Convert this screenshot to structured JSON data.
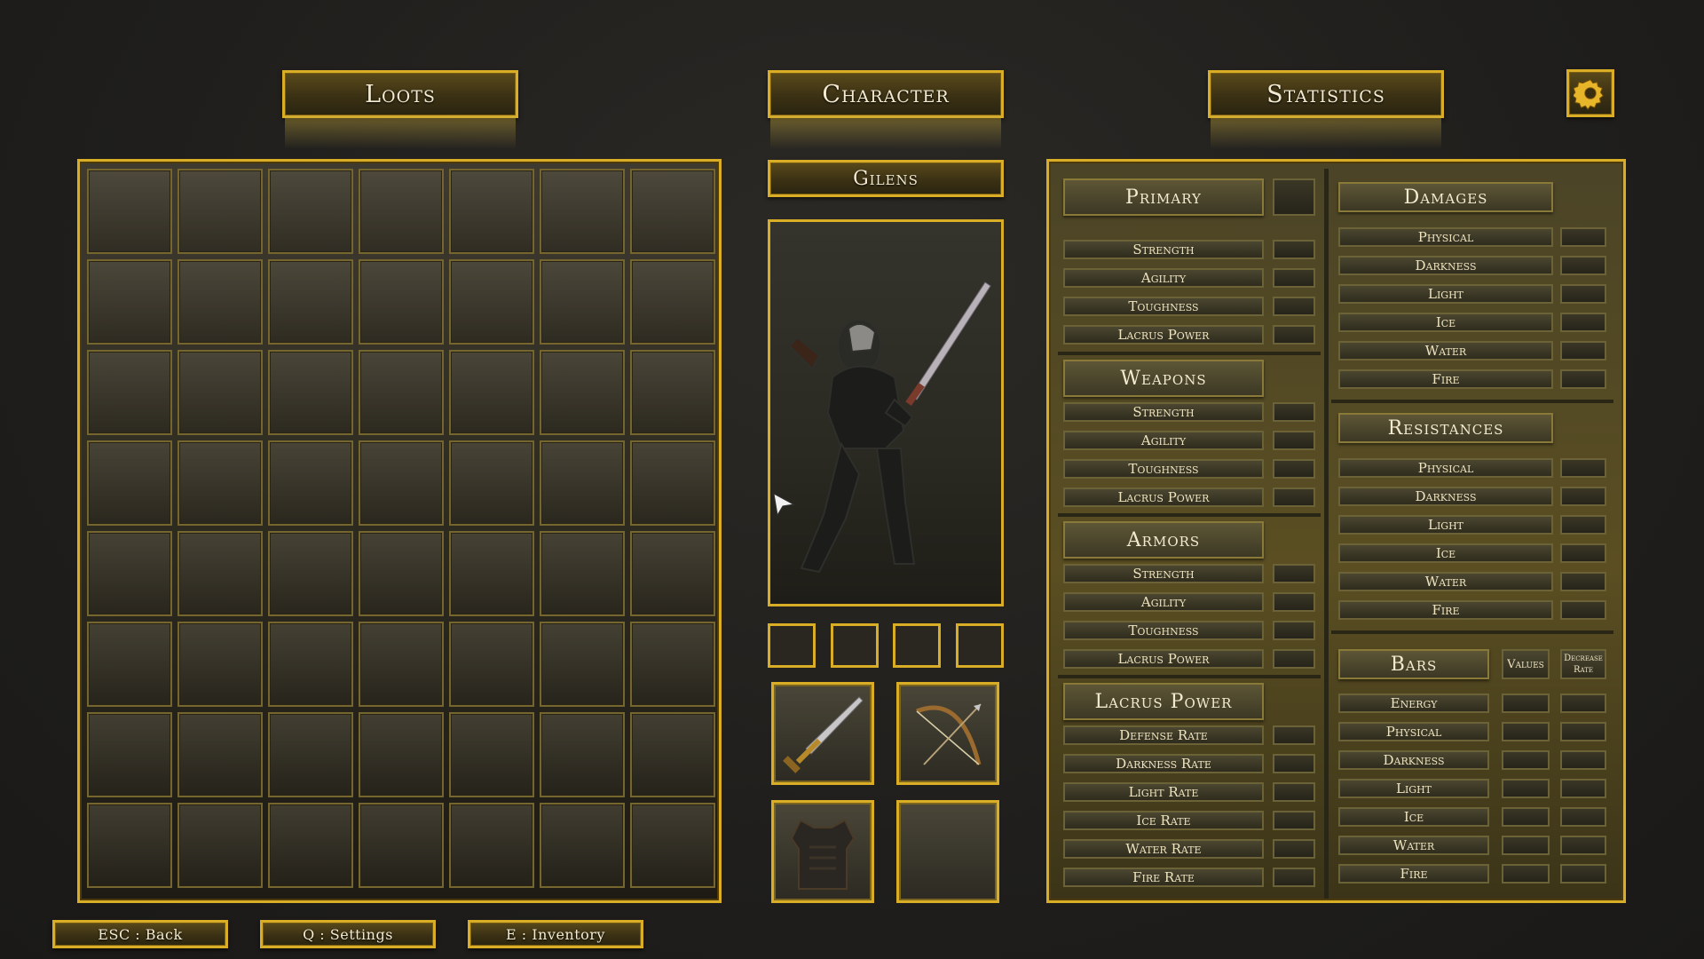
{
  "tabs": {
    "loots": "Loots",
    "character": "Character",
    "statistics": "Statistics"
  },
  "character_name": "Gilens",
  "icons": {
    "settings": "gear-icon",
    "sword": "sword-icon",
    "bow": "bow-icon",
    "armor": "chest-armor-icon"
  },
  "colors": {
    "gold": "#d9ad26",
    "background": "#1f1e1c"
  },
  "stats": {
    "primary": {
      "title": "Primary",
      "items": [
        "Strength",
        "Agility",
        "Toughness",
        "Lacrus Power"
      ]
    },
    "weapons": {
      "title": "Weapons",
      "items": [
        "Strength",
        "Agility",
        "Toughness",
        "Lacrus Power"
      ]
    },
    "armors": {
      "title": "Armors",
      "items": [
        "Strength",
        "Agility",
        "Toughness",
        "Lacrus Power"
      ]
    },
    "lacrus": {
      "title": "Lacrus Power",
      "items": [
        "Defense Rate",
        "Darkness Rate",
        "Light Rate",
        "Ice Rate",
        "Water Rate",
        "Fire Rate"
      ]
    },
    "damages": {
      "title": "Damages",
      "items": [
        "Physical",
        "Darkness",
        "Light",
        "Ice",
        "Water",
        "Fire"
      ]
    },
    "resistances": {
      "title": "Resistances",
      "items": [
        "Physical",
        "Darkness",
        "Light",
        "Ice",
        "Water",
        "Fire"
      ]
    },
    "bars": {
      "title": "Bars",
      "values_header": "Values",
      "rate_header_1": "Decrease",
      "rate_header_2": "Rate",
      "items": [
        "Energy",
        "Physical",
        "Darkness",
        "Light",
        "Ice",
        "Water",
        "Fire"
      ]
    }
  },
  "footer": {
    "back": "ESC : Back",
    "settings": "Q : Settings",
    "inventory": "E : Inventory"
  }
}
